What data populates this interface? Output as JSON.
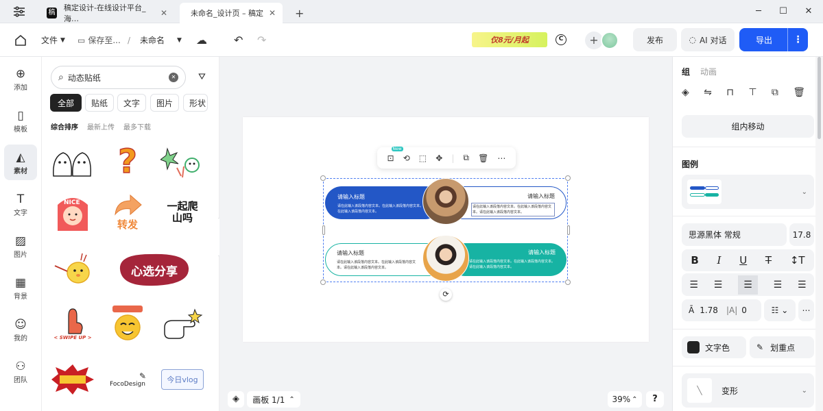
{
  "titlebar": {
    "tab1": "稿定设计-在线设计平台_海…",
    "tab2": "未命名_设计页 – 稿定",
    "app_badge": "稿"
  },
  "toolbar": {
    "file": "文件",
    "save_to": "保存至...",
    "slash": "/",
    "doc_name": "未命名",
    "promo": "仅8元/月起",
    "publish": "发布",
    "ai_chat": "AI 对话",
    "export": "导出"
  },
  "rail": [
    {
      "label": "添加",
      "icon": "⊕"
    },
    {
      "label": "模板",
      "icon": "▯"
    },
    {
      "label": "素材",
      "icon": "◭"
    },
    {
      "label": "文字",
      "icon": "T"
    },
    {
      "label": "图片",
      "icon": "▨"
    },
    {
      "label": "背景",
      "icon": "▦"
    },
    {
      "label": "我的",
      "icon": "☺"
    },
    {
      "label": "团队",
      "icon": "⚇"
    }
  ],
  "panel": {
    "search_value": "动态贴纸",
    "chips": [
      "全部",
      "贴纸",
      "文字",
      "图片",
      "形状"
    ],
    "sorts": [
      "综合排序",
      "最新上传",
      "最多下载"
    ],
    "sticker_texts": {
      "nice": "NICE",
      "share_forward": "转发",
      "climb": "一起爬山吗",
      "xuan": "心选分享",
      "swipe": "< SWIPE UP >",
      "foco": "FocoDesign",
      "vlog": "今日vlog"
    }
  },
  "canvas": {
    "new_badge": "New",
    "row1_left_title": "请输入标题",
    "row1_left_body": "请在此输入该段落内容文本。在此输入该段落内容文本。请在此输入该段落内容文本。",
    "row1_right_title": "请输入标题",
    "row1_right_body": "请在此输入该段落内容文本。在此输入该段落内容文本。请在此输入该段落内容文本。",
    "row2_left_title": "请输入标题",
    "row2_left_body": "请在此输入该段落内容文本。在此输入该段落内容文本。请在此输入该段落内容文本。",
    "row2_right_title": "请输入标题",
    "row2_right_body": "请在此输入该段落内容文本。在此输入该段落内容文本。请在此输入该段落内容文本。",
    "board_label": "画板 1/1",
    "zoom": "39%",
    "help": "?"
  },
  "right": {
    "tab_group": "组",
    "tab_anim": "动画",
    "move_in_group": "组内移动",
    "legend_title": "图例",
    "font_name": "思源黑体 常规",
    "font_size": "17.8",
    "line_height": "1.78",
    "letter_spacing": "0",
    "text_color": "文字色",
    "highlight": "划重点",
    "transform": "变形"
  },
  "colors": {
    "accent": "#1f5cf6",
    "blue_pill": "#2357c6",
    "teal_pill": "#17b3a3"
  }
}
